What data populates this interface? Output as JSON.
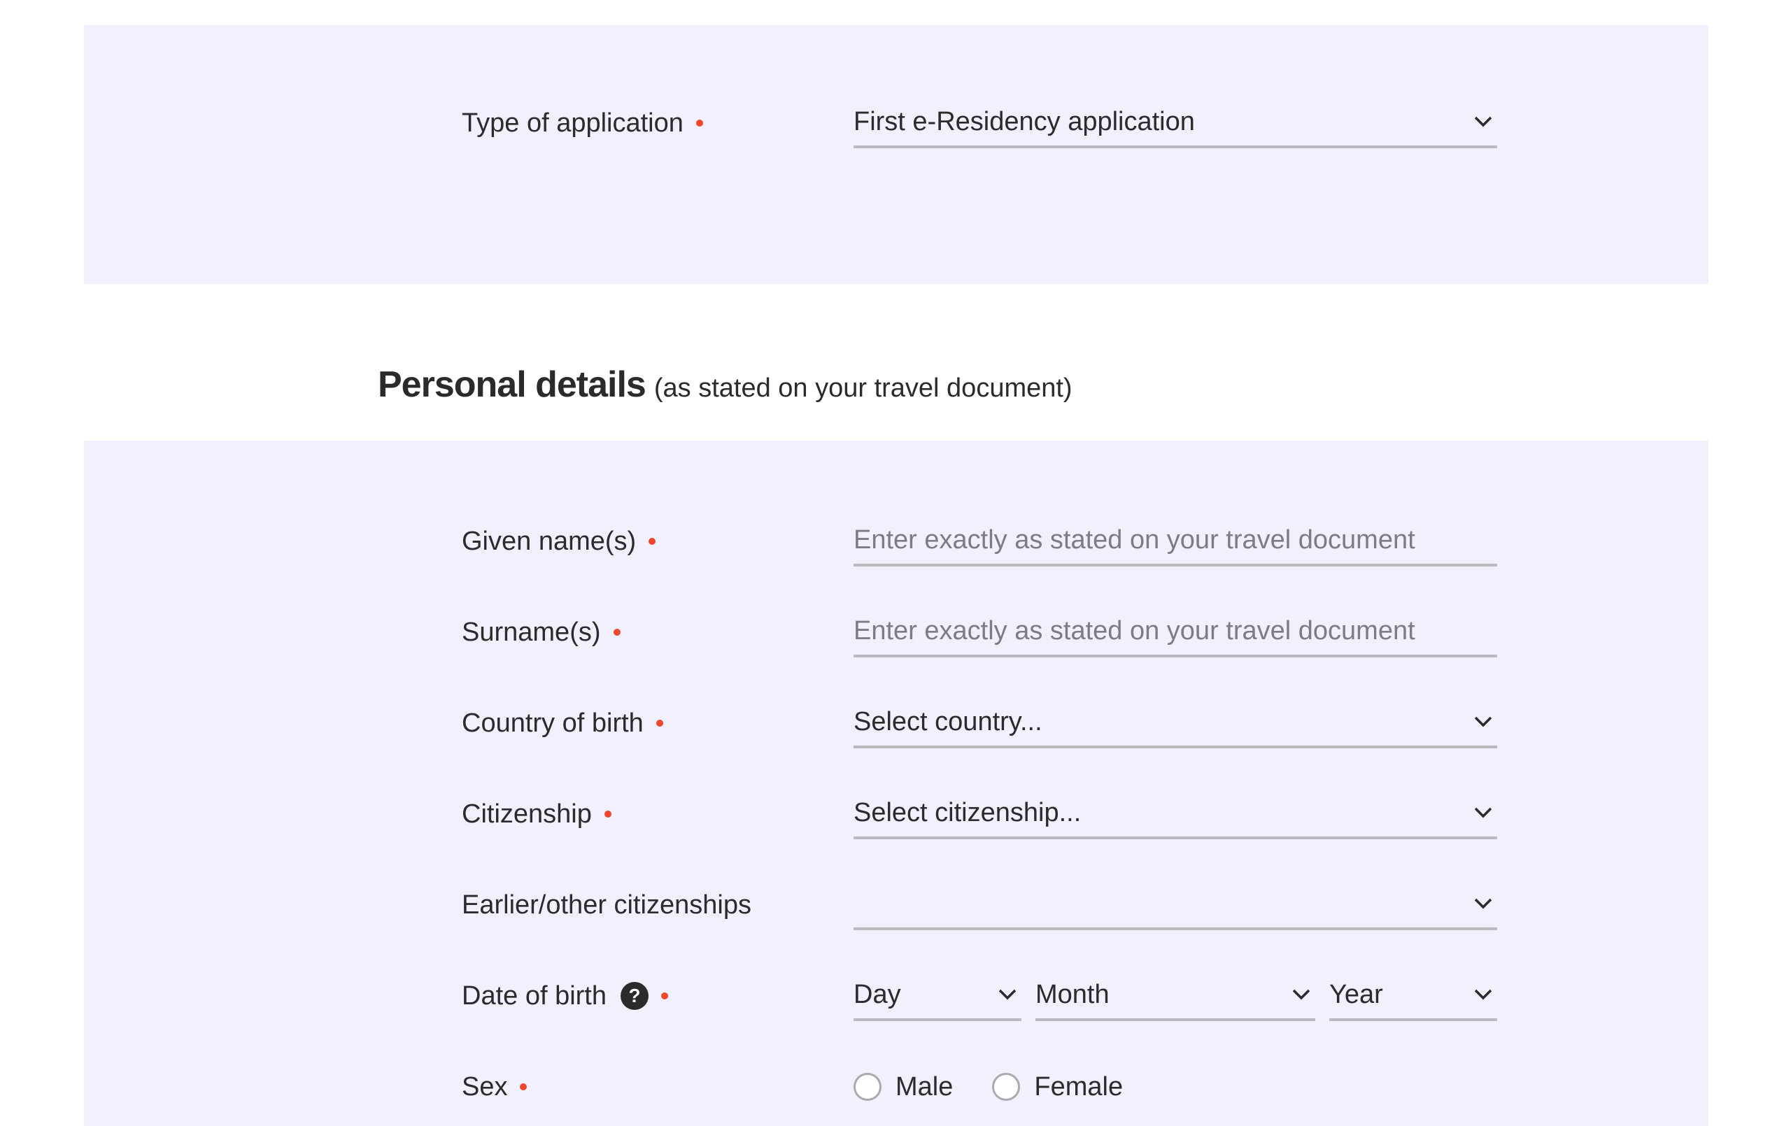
{
  "application_type": {
    "label": "Type of application",
    "value": "First e-Residency application"
  },
  "personal_details": {
    "title": "Personal details",
    "subtitle": "(as stated on your travel document)",
    "given_names": {
      "label": "Given name(s)",
      "placeholder": "Enter exactly as stated on your travel document",
      "value": ""
    },
    "surnames": {
      "label": "Surname(s)",
      "placeholder": "Enter exactly as stated on your travel document",
      "value": ""
    },
    "country_of_birth": {
      "label": "Country of birth",
      "value": "Select country..."
    },
    "citizenship": {
      "label": "Citizenship",
      "value": "Select citizenship..."
    },
    "other_citizenships": {
      "label": "Earlier/other citizenships",
      "value": ""
    },
    "date_of_birth": {
      "label": "Date of birth",
      "help": "?",
      "day": "Day",
      "month": "Month",
      "year": "Year"
    },
    "sex": {
      "label": "Sex",
      "options": [
        "Male",
        "Female"
      ],
      "selected": null
    }
  },
  "colors": {
    "panel_bg": "#f0f1fd",
    "required_dot": "#f0462d",
    "underline": "#b9b9c0",
    "text": "#2b2b2b",
    "placeholder": "#7c7c82"
  },
  "icons": [
    "chevron-down-icon",
    "help-icon",
    "required-dot-icon",
    "radio-icon"
  ]
}
